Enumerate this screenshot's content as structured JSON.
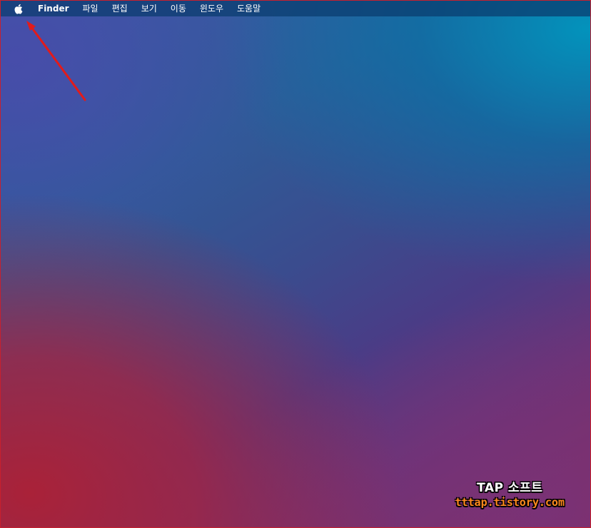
{
  "menubar": {
    "apple_icon": "apple-icon",
    "app_name": "Finder",
    "items": [
      {
        "label": "파일"
      },
      {
        "label": "편집"
      },
      {
        "label": "보기"
      },
      {
        "label": "이동"
      },
      {
        "label": "윈도우"
      },
      {
        "label": "도움말"
      }
    ]
  },
  "annotation": {
    "arrow_color": "#e21b1b"
  },
  "watermark": {
    "title": "TAP 소프트",
    "url": "tttap.tistory.com"
  }
}
